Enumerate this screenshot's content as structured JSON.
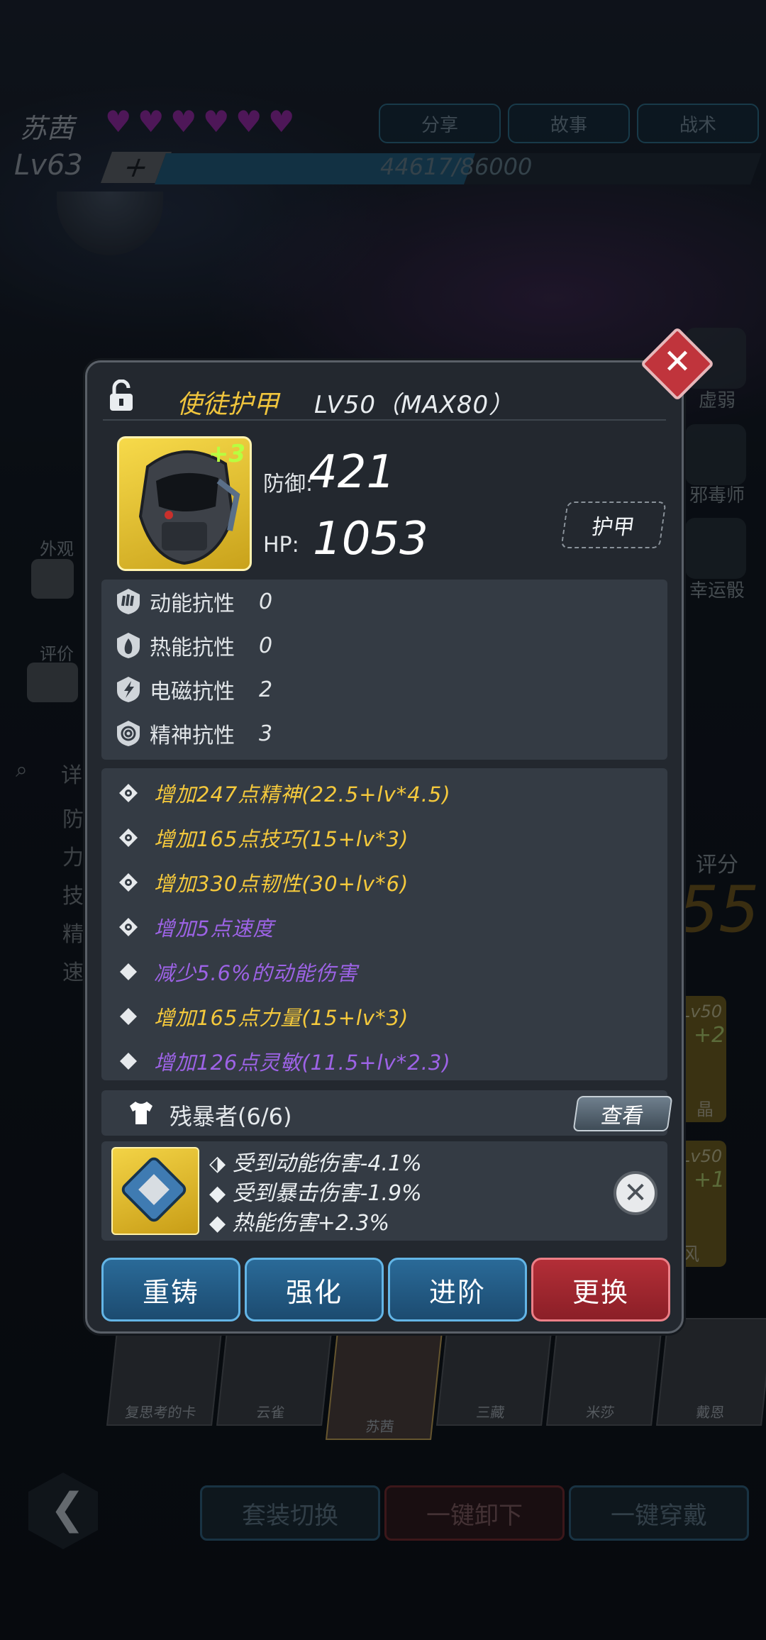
{
  "header": {
    "character_name": "苏茜",
    "hearts": 6,
    "level": "Lv63",
    "xp_text": "44617/86000",
    "xp_progress": 0.519,
    "buttons": [
      "分享",
      "故事",
      "战术"
    ]
  },
  "left_side": {
    "appearance_label": "外观",
    "rating_label": "评价",
    "detail_label": "详",
    "attr_labels": [
      "防",
      "力",
      "技",
      "精",
      "速"
    ]
  },
  "right_side": {
    "labels": [
      "虚弱",
      "邪毒师",
      "幸运骰"
    ],
    "score_label": "评分",
    "score_value": "55",
    "card1_level": "Lv50",
    "card1_plus": "+2",
    "card1_name": "晶",
    "card2_level": "Lv50",
    "card2_plus": "+1",
    "card2_name": "风"
  },
  "modal": {
    "item_name": "使徒护甲",
    "level_text": "LV50（MAX80）",
    "plus": "+3",
    "defense_label": "防御:",
    "defense_value": "421",
    "hp_label": "HP:",
    "hp_value": "1053",
    "type_button": "护甲",
    "resistances": [
      {
        "label": "动能抗性",
        "value": "0",
        "icon": "kinetic-icon"
      },
      {
        "label": "热能抗性",
        "value": "0",
        "icon": "fire-icon"
      },
      {
        "label": "电磁抗性",
        "value": "2",
        "icon": "lightning-icon"
      },
      {
        "label": "精神抗性",
        "value": "3",
        "icon": "spiral-icon"
      }
    ],
    "attributes": [
      {
        "text": "增加247点精神(22.5+lv*4.5)",
        "color": "#f5c93c",
        "marker": "gear"
      },
      {
        "text": "增加165点技巧(15+lv*3)",
        "color": "#f5c93c",
        "marker": "gear"
      },
      {
        "text": "增加330点韧性(30+lv*6)",
        "color": "#f5c93c",
        "marker": "gear"
      },
      {
        "text": "增加5点速度",
        "color": "#9d63e6",
        "marker": "gear"
      },
      {
        "text": "减少5.6%的动能伤害",
        "color": "#9d63e6",
        "marker": "diamond"
      },
      {
        "text": "增加165点力量(15+lv*3)",
        "color": "#f5c93c",
        "marker": "diamond"
      },
      {
        "text": "增加126点灵敏(11.5+lv*2.3)",
        "color": "#9d63e6",
        "marker": "diamond"
      }
    ],
    "set_name": "残暴者(6/6)",
    "view_button": "查看",
    "gem_effects": [
      "受到动能伤害-4.1%",
      "受到暴击伤害-1.9%",
      "热能伤害+2.3%"
    ],
    "actions": [
      "重铸",
      "强化",
      "进阶",
      "更换"
    ]
  },
  "roster": {
    "names": [
      "复思考的卡",
      "云雀",
      "苏茜",
      "三藏",
      "米莎",
      "戴恩"
    ],
    "selected_index": 2
  },
  "bottom_buttons": [
    "套装切换",
    "一键卸下",
    "一键穿戴"
  ],
  "colors": {
    "gold": "#f5c93c",
    "purple": "#9d63e6",
    "action_blue": "#2a6a98",
    "action_red": "#b32e37"
  }
}
